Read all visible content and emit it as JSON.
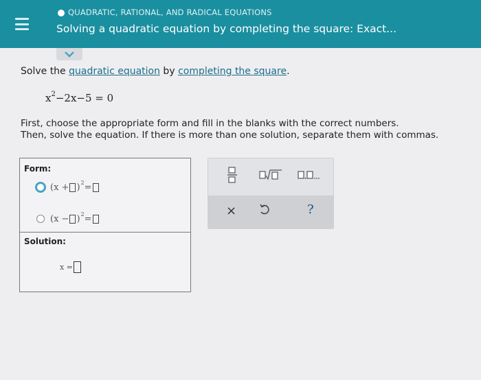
{
  "header": {
    "topic": "QUADRATIC, RATIONAL, AND RADICAL EQUATIONS",
    "title": "Solving a quadratic equation by completing the square: Exact..."
  },
  "question": {
    "prefix": "Solve the ",
    "link1": "quadratic equation",
    "middle": " by ",
    "link2": "completing the square",
    "suffix": "."
  },
  "equation": {
    "x": "x",
    "exp": "2",
    "rest": "−2x−5 = 0"
  },
  "instructions": {
    "line1": "First, choose the appropriate form and fill in the blanks with the correct numbers.",
    "line2": "Then, solve the equation. If there is more than one solution, separate them with commas."
  },
  "panel": {
    "form_label": "Form:",
    "option1": {
      "open": "(x + ",
      "close": ")",
      "exp": "2",
      "eq": " = ",
      "selected": true
    },
    "option2": {
      "open": "(x − ",
      "close": ")",
      "exp": "2",
      "eq": " = ",
      "selected": false
    },
    "solution_label": "Solution:",
    "solution_prefix": "x = "
  },
  "keypad": {
    "clear_symbol": "×",
    "help_symbol": "?",
    "icons": [
      "fraction-icon",
      "sqrt-icon",
      "list-icon",
      "close-icon",
      "undo-icon",
      "help-icon"
    ]
  }
}
